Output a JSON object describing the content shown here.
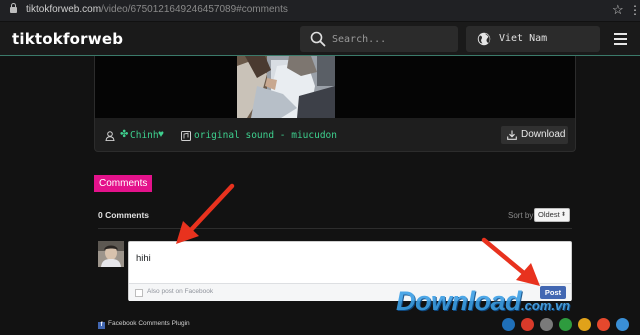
{
  "browser": {
    "url_host": "tiktokforweb.com",
    "url_path": "/video/6750121649246457089#comments"
  },
  "header": {
    "logo": "tiktokforweb",
    "search_placeholder": "Search...",
    "language": "Viet Nam"
  },
  "video": {
    "author": "Chinh",
    "sound": "original sound - miucudon",
    "download_label": "Download"
  },
  "comments": {
    "section_title": "Comments",
    "count_label": "0 Comments",
    "sort_label": "Sort by",
    "sort_value": "Oldest",
    "draft_text": "hihi",
    "also_post_label": "Also post on Facebook",
    "post_label": "Post",
    "plugin_label": "Facebook Comments Plugin"
  },
  "watermark": {
    "brand": "Download",
    "tld": ".com.vn",
    "dot_colors": [
      "#1f6fb8",
      "#d83a2a",
      "#7a7a7a",
      "#2e9b3e",
      "#e0a21a",
      "#e5482d",
      "#3a8fd6"
    ]
  },
  "colors": {
    "accent_green": "#3ecf8e",
    "comments_pink": "#e4128b",
    "facebook_blue": "#4267b2",
    "annotation_red": "#e8321e"
  }
}
